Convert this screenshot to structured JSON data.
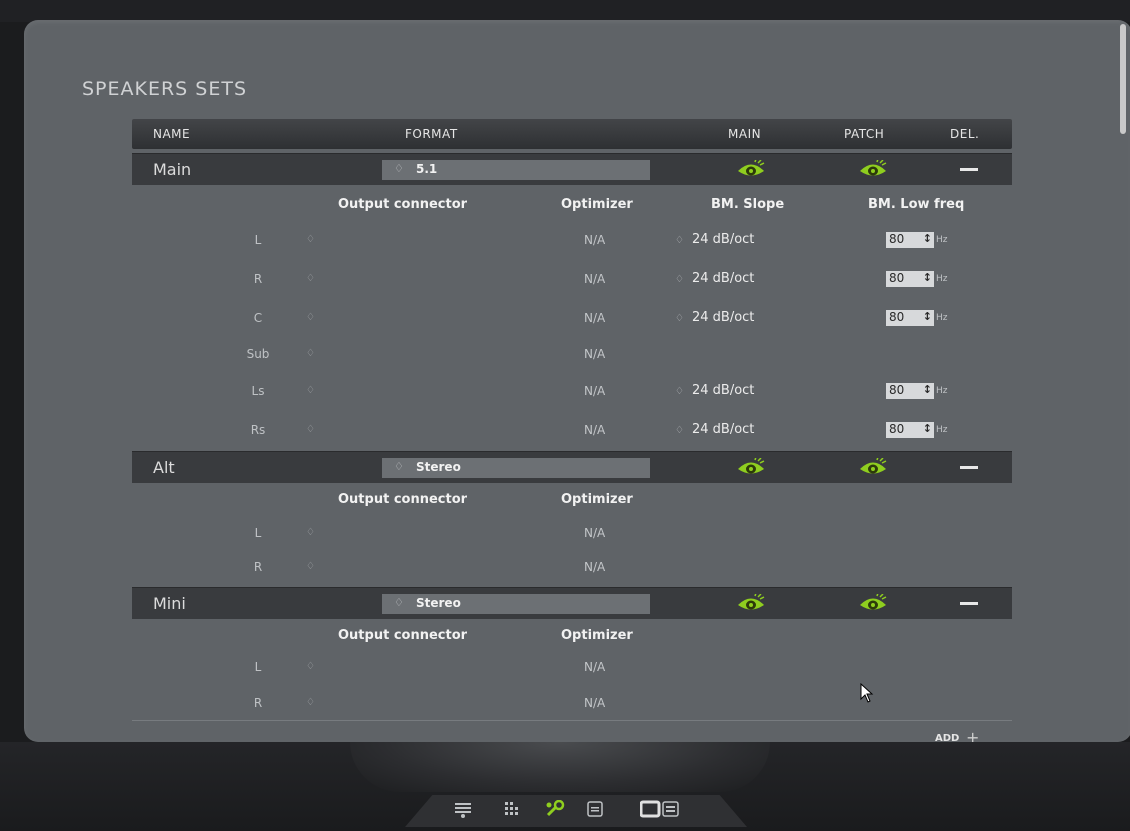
{
  "title": "SPEAKERS SETS",
  "columns": {
    "name": "NAME",
    "format": "FORMAT",
    "main": "MAIN",
    "patch": "PATCH",
    "del": "DEL."
  },
  "detail_headers": {
    "output": "Output connector",
    "optimizer": "Optimizer",
    "slope": "BM. Slope",
    "lowfreq": "BM. Low freq"
  },
  "colors": {
    "panel": "#5f6367",
    "header_bar": "#3a3c3f",
    "eye_accent": "#8fce1f",
    "field": "#6c7074"
  },
  "sets": [
    {
      "name": "Main",
      "format": "5.1",
      "channels": [
        {
          "ch": "L",
          "optimizer": "N/A",
          "slope": "24 dB/oct",
          "freq": "80",
          "unit": "Hz"
        },
        {
          "ch": "R",
          "optimizer": "N/A",
          "slope": "24 dB/oct",
          "freq": "80",
          "unit": "Hz"
        },
        {
          "ch": "C",
          "optimizer": "N/A",
          "slope": "24 dB/oct",
          "freq": "80",
          "unit": "Hz"
        },
        {
          "ch": "Sub",
          "optimizer": "N/A"
        },
        {
          "ch": "Ls",
          "optimizer": "N/A",
          "slope": "24 dB/oct",
          "freq": "80",
          "unit": "Hz"
        },
        {
          "ch": "Rs",
          "optimizer": "N/A",
          "slope": "24 dB/oct",
          "freq": "80",
          "unit": "Hz"
        }
      ]
    },
    {
      "name": "Alt",
      "format": "Stereo",
      "channels": [
        {
          "ch": "L",
          "optimizer": "N/A"
        },
        {
          "ch": "R",
          "optimizer": "N/A"
        }
      ]
    },
    {
      "name": "Mini",
      "format": "Stereo",
      "channels": [
        {
          "ch": "L",
          "optimizer": "N/A"
        },
        {
          "ch": "R",
          "optimizer": "N/A"
        }
      ]
    }
  ],
  "add_label": "ADD",
  "dock_icons": [
    "speakers-icon",
    "matrix-icon",
    "tools-icon",
    "list-icon",
    "display-icon"
  ]
}
